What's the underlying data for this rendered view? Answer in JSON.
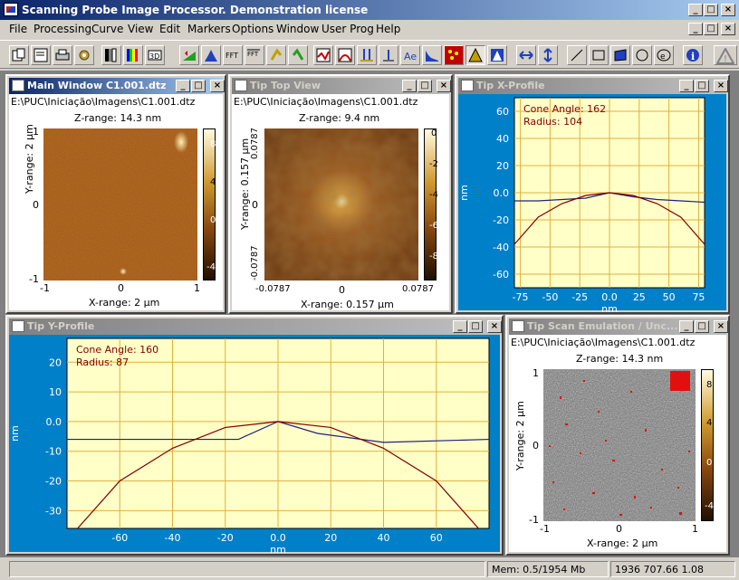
{
  "app": {
    "title": "Scanning Probe Image Processor. Demonstration license"
  },
  "menu": [
    "File",
    "Processing",
    "Curve",
    "View",
    "Edit",
    "Markers",
    "Options",
    "Window",
    "User Prog",
    "Help"
  ],
  "windows": {
    "main": {
      "title": "Main Window C1.001.dtz",
      "path": "E:\\PUC\\Iniciação\\Imagens\\C1.001.dtz",
      "zrange": "Z-range: 14.3 nm",
      "xrange": "X-range: 2 µm",
      "yrange": "Y-range: 2 µm",
      "xticks": [
        "-1",
        "0",
        "1"
      ],
      "yticks": [
        "1",
        "0",
        "-1"
      ],
      "cbar_ticks": [
        "8",
        "4",
        "0",
        "-4"
      ]
    },
    "tip_top": {
      "title": "Tip Top View",
      "path": "E:\\PUC\\Iniciação\\Imagens\\C1.001.dtz",
      "zrange": "Z-range: 9.4 nm",
      "xrange": "X-range: 0.157 µm",
      "yrange": "Y-range: 0.157 µm",
      "xticks": [
        "-0.0787",
        "0",
        "0.0787"
      ],
      "yticks": [
        "0.0787",
        "0",
        "-0.0787"
      ],
      "cbar_ticks": [
        "0",
        "-2",
        "-4",
        "-6",
        "-8"
      ]
    },
    "tip_x": {
      "title": "Tip X-Profile",
      "annotation": [
        "Cone Angle: 162",
        "Radius:  104"
      ],
      "ylabel": "nm",
      "xlabel": "nm",
      "yticks": [
        "60",
        "40",
        "20",
        "0.0",
        "-20",
        "-40",
        "-60"
      ],
      "xticks": [
        "-75",
        "-50",
        "-25",
        "0.0",
        "25",
        "50",
        "75"
      ]
    },
    "tip_y": {
      "title": "Tip Y-Profile",
      "annotation": [
        "Cone Angle: 160",
        "Radius:   87"
      ],
      "ylabel": "nm",
      "xlabel": "nm",
      "yticks": [
        "20",
        "10",
        "0.0",
        "-10",
        "-20",
        "-30"
      ],
      "xticks": [
        "-60",
        "-40",
        "-20",
        "0.0",
        "20",
        "40",
        "60"
      ]
    },
    "tip_scan": {
      "title": "Tip Scan Emulation / Unc...",
      "path": "E:\\PUC\\Iniciação\\Imagens\\C1.001.dtz",
      "zrange": "Z-range: 14.3 nm",
      "xrange": "X-range: 2 µm",
      "yrange": "Y-range: 2 µm",
      "xticks": [
        "-1",
        "0",
        "1"
      ],
      "yticks": [
        "1",
        "0",
        "-1"
      ],
      "cbar_ticks": [
        "8",
        "4",
        "0",
        "-4"
      ]
    }
  },
  "chart_data": [
    {
      "type": "line",
      "title": "Tip X-Profile",
      "xlabel": "nm",
      "ylabel": "nm",
      "xlim": [
        -80,
        80
      ],
      "ylim": [
        -70,
        70
      ],
      "series": [
        {
          "x": [
            -80,
            -60,
            -40,
            -20,
            0,
            20,
            40,
            60,
            80
          ],
          "y": [
            -6,
            -6,
            -5,
            -4,
            0,
            -3,
            -5,
            -6,
            -7
          ]
        },
        {
          "x": [
            -80,
            -60,
            -40,
            -20,
            0,
            20,
            40,
            60,
            80
          ],
          "y": [
            -38,
            -18,
            -8,
            -2,
            0,
            -2,
            -8,
            -18,
            -38
          ]
        }
      ]
    },
    {
      "type": "line",
      "title": "Tip Y-Profile",
      "xlabel": "nm",
      "ylabel": "nm",
      "xlim": [
        -80,
        80
      ],
      "ylim": [
        -36,
        28
      ],
      "series": [
        {
          "x": [
            -80,
            -40,
            -15,
            0,
            15,
            40,
            80
          ],
          "y": [
            -6,
            -6,
            -6,
            0,
            -4,
            -7,
            -6
          ]
        },
        {
          "x": [
            -80,
            -60,
            -40,
            -20,
            0,
            20,
            40,
            60,
            80
          ],
          "y": [
            -40,
            -20,
            -9,
            -2,
            0,
            -2,
            -9,
            -20,
            -40
          ]
        }
      ]
    }
  ],
  "status": {
    "mem": "Mem: 0.5/1954 Mb",
    "coords": "1936 707.66 1.08"
  }
}
